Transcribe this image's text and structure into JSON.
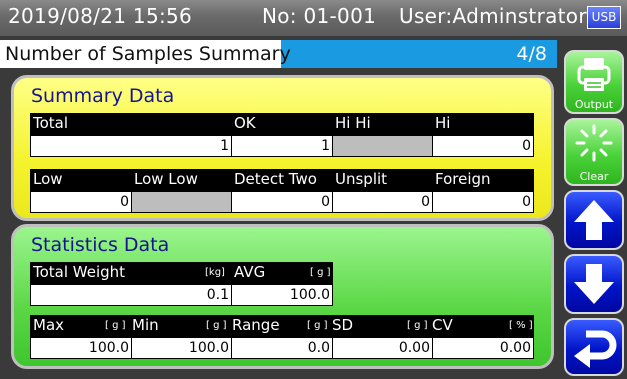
{
  "status_bar": {
    "datetime": "2019/08/21 15:56",
    "number": "No: 01-001",
    "user": "User:Adminstrator",
    "usb_label": "USB"
  },
  "header": {
    "title": "Number of Samples Summary",
    "page": "4/8"
  },
  "summary": {
    "title": "Summary Data",
    "row1_headers": [
      "Total",
      "OK",
      "Hi Hi",
      "Hi"
    ],
    "row1_values": [
      "1",
      "1",
      "",
      "0"
    ],
    "row2_headers": [
      "Low",
      "Low Low",
      "Detect Two",
      "Unsplit",
      "Foreign"
    ],
    "row2_values": [
      "0",
      "",
      "0",
      "0",
      "0"
    ]
  },
  "statistics": {
    "title": "Statistics Data",
    "weight_headers": [
      {
        "label": "Total Weight",
        "unit": "[kg]"
      },
      {
        "label": "AVG",
        "unit": "[ g ]"
      }
    ],
    "weight_values": [
      "0.1",
      "100.0"
    ],
    "stat_headers": [
      {
        "label": "Max",
        "unit": "[ g ]"
      },
      {
        "label": "Min",
        "unit": "[ g ]"
      },
      {
        "label": "Range",
        "unit": "[ g ]"
      },
      {
        "label": "SD",
        "unit": "[ g ]"
      },
      {
        "label": "CV",
        "unit": "[ % ]"
      }
    ],
    "stat_values": [
      "100.0",
      "100.0",
      "0.0",
      "0.00",
      "0.00"
    ]
  },
  "side_buttons": {
    "output_label": "Output",
    "clear_label": "Clear",
    "icons": [
      "printer-icon",
      "clear-icon",
      "arrow-up-icon",
      "arrow-down-icon",
      "return-icon"
    ]
  },
  "colors": {
    "title_bar": "#1a9ae0",
    "summary_panel": "#f5f32d",
    "statistics_panel": "#5ad644",
    "header_row": "#000000",
    "disabled_cell": "#bdbdbd",
    "green_button": "#4bd23a",
    "blue_button": "#0014c8"
  }
}
